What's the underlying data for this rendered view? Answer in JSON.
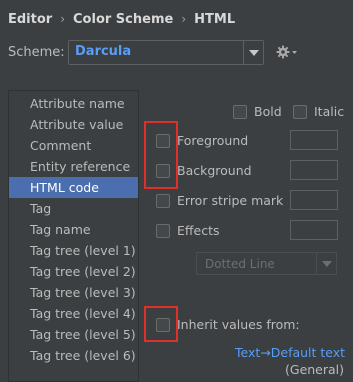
{
  "breadcrumb": {
    "items": [
      "Editor",
      "Color Scheme",
      "HTML"
    ],
    "separator": "›"
  },
  "scheme": {
    "label": "Scheme:",
    "value": "Darcula",
    "settings_icon": "gear-icon"
  },
  "list": {
    "items": [
      "Attribute name",
      "Attribute value",
      "Comment",
      "Entity reference",
      "HTML code",
      "Tag",
      "Tag name",
      "Tag tree (level 1)",
      "Tag tree (level 2)",
      "Tag tree (level 3)",
      "Tag tree (level 4)",
      "Tag tree (level 5)",
      "Tag tree (level 6)"
    ],
    "selected": "HTML code"
  },
  "options": {
    "bold": "Bold",
    "italic": "Italic",
    "foreground": "Foreground",
    "background": "Background",
    "error_stripe": "Error stripe mark",
    "effects": "Effects",
    "effect_type": "Dotted Line",
    "inherit": "Inherit values from:",
    "inherit_link": "Text→Default text",
    "inherit_scope": "(General)"
  },
  "colors": {
    "accent": "#589df6",
    "selection": "#4b6eaf",
    "highlight_box": "#e0302a",
    "background": "#3c3f41"
  }
}
